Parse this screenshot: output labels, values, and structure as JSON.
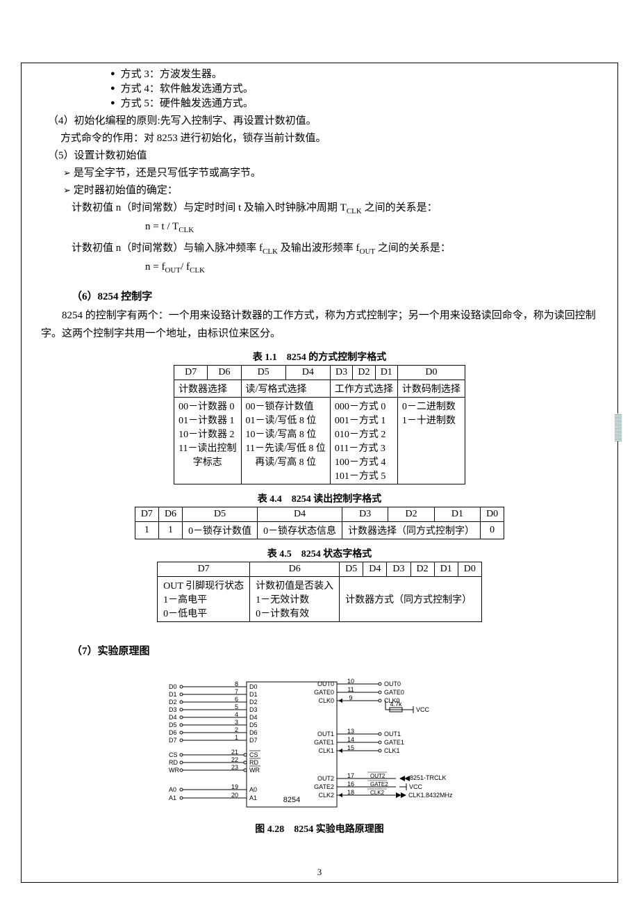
{
  "bullets": [
    "方式 3：方波发生器。",
    "方式 4：软件触发选通方式。",
    "方式 5：硬件触发选通方式。"
  ],
  "item4": "（4）初始化编程的原则:先写入控制字、再设置计数初值。",
  "item4_sub": "方式命令的作用：对 8253 进行初始化，锁存当前计数值。",
  "item5": "（5）设置计数初始值",
  "arrow1": "是写全字节，还是只写低字节或高字节。",
  "arrow2": "定时器初始值的确定：",
  "timer_rel_pre": "计数初值 n（时间常数）与定时时间 t 及输入时钟脉冲周期 T",
  "timer_rel_post": "之间的关系是：",
  "formula1_a": "n = t / T",
  "formula1_sub": "CLK",
  "freq_rel_pre": "计数初值 n（时间常数）与输入脉冲频率 f",
  "freq_rel_mid": "及输出波形频率 f",
  "freq_rel_post": "之间的关系是：",
  "formula2_a": "n = f",
  "formula2_sub1": "OUT",
  "formula2_mid": "/ f",
  "formula2_sub2": "CLK",
  "item6_head": "（6）8254 控制字",
  "item6_para": "8254 的控制字有两个：一个用来设臵计数器的工作方式，称为方式控制字；另一个用来设臵读回命令，称为读回控制字。这两个控制字共用一个地址，由标识位来区分。",
  "caption1": "表 1.1　8254 的方式控制字格式",
  "t1": {
    "h": [
      "D7",
      "D6",
      "D5",
      "D4",
      "D3",
      "D2",
      "D1",
      "D0"
    ],
    "grp": [
      "计数器选择",
      "读/写格式选择",
      "工作方式选择",
      "计数码制选择"
    ],
    "rows": [
      [
        "00－计数器 0",
        "00－锁存计数值",
        "000－方式 0",
        "0－二进制数"
      ],
      [
        "01－计数器 1",
        "01－读/写低 8 位",
        "001－方式 1",
        "1－十进制数"
      ],
      [
        "10－计数器 2",
        "10－读/写高 8 位",
        "010－方式 2",
        ""
      ],
      [
        "11－读出控制\n字标志",
        "11－先读/写低 8 位\n再读/写高 8 位",
        "011－方式 3",
        ""
      ],
      [
        "",
        "",
        "100－方式 4",
        ""
      ],
      [
        "",
        "",
        "101－方式 5",
        ""
      ]
    ]
  },
  "caption2": "表 4.4　8254 读出控制字格式",
  "t2": {
    "h": [
      "D7",
      "D6",
      "D5",
      "D4",
      "D3",
      "D2",
      "D1",
      "D0"
    ],
    "r": [
      "1",
      "1",
      "0－锁存计数值",
      "0－锁存状态信息",
      "计数器选择（同方式控制字）",
      "0"
    ]
  },
  "caption3": "表 4.5　8254 状态字格式",
  "t3": {
    "h": [
      "D7",
      "D6",
      "D5",
      "D4",
      "D3",
      "D2",
      "D1",
      "D0"
    ],
    "c1": [
      "OUT 引脚现行状态",
      "1－高电平",
      "0－低电平"
    ],
    "c2": [
      "计数初值是否装入",
      "1－无效计数",
      "0－计数有效"
    ],
    "c3": "计数器方式（同方式控制字）"
  },
  "item7_head": "（7）实验原理图",
  "sch_caption": "图 4.28　8254 实验电路原理图",
  "page_num": "3",
  "schematic": {
    "left_pins": [
      "D0",
      "D1",
      "D2",
      "D3",
      "D4",
      "D5",
      "D6",
      "D7",
      "CS",
      "RD",
      "WR",
      "A0",
      "A1"
    ],
    "left_nums": [
      "8",
      "7",
      "6",
      "5",
      "4",
      "3",
      "2",
      "1",
      "21",
      "22",
      "23",
      "19",
      "20"
    ],
    "chip_left": [
      "D0",
      "D1",
      "D2",
      "D3",
      "D4",
      "D5",
      "D6",
      "D7",
      "CS",
      "RD",
      "WR",
      "A0",
      "A1"
    ],
    "chip_right_g0": [
      "OUT0",
      "GATE0",
      "CLK0"
    ],
    "chip_right_g1": [
      "OUT1",
      "GATE1",
      "CLK1"
    ],
    "chip_right_g2": [
      "OUT2",
      "GATE2",
      "CLK2"
    ],
    "num_g0": [
      "10",
      "11",
      "9"
    ],
    "num_g1": [
      "13",
      "14",
      "15"
    ],
    "num_g2": [
      "17",
      "16",
      "18"
    ],
    "ext_g0": [
      "OUT0",
      "GATE0",
      "CLK0"
    ],
    "ext_g1": [
      "OUT1",
      "GATE1",
      "CLK1"
    ],
    "ext_g2_labels": [
      "OUT2",
      "GATE2",
      "CLK2"
    ],
    "chip_name": "8254",
    "r_label": "4.7k",
    "vcc": "VCC",
    "trclk": "8251-TRCLK",
    "clk_src": "CLK1.8432MHz"
  }
}
